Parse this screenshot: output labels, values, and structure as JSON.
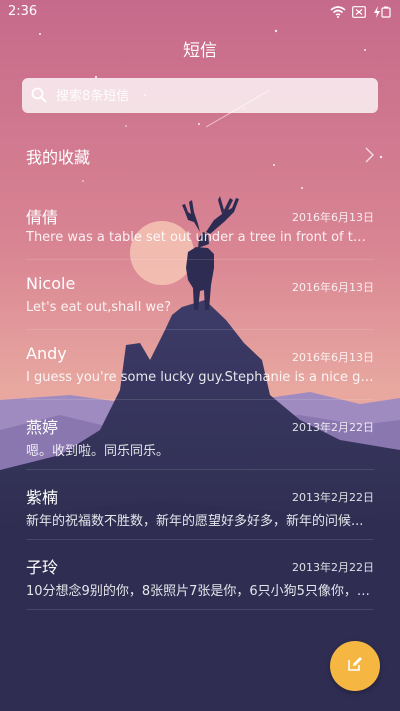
{
  "status_bar": {
    "time": "2:36",
    "icons": [
      "wifi-icon",
      "sim-card-icon",
      "charging-icon"
    ]
  },
  "header": {
    "title": "短信"
  },
  "search": {
    "placeholder": "搜索8条短信"
  },
  "favorites": {
    "label": "我的收藏",
    "icon": "chevron-right-icon"
  },
  "conversations": [
    {
      "name": "倩倩",
      "date": "2016年6月13日",
      "preview": "There was a table set out under a tree in front of the ho..."
    },
    {
      "name": "Nicole",
      "date": "2016年6月13日",
      "preview": "Let's eat out,shall we?"
    },
    {
      "name": "Andy",
      "date": "2016年6月13日",
      "preview": "I guess you're some lucky guy.Stephanie is a nice girl."
    },
    {
      "name": "燕婷",
      "date": "2013年2月22日",
      "preview": "嗯。收到啦。同乐同乐。"
    },
    {
      "name": "紫楠",
      "date": "2013年2月22日",
      "preview": "新年的祝福数不胜数，新年的愿望好多好多，新年的问候..."
    },
    {
      "name": "子玲",
      "date": "2013年2月22日",
      "preview": "10分想念9别的你，8张照片7张是你，6只小狗5只像你，4..."
    }
  ],
  "fab": {
    "icon": "compose-icon",
    "color": "#f5b642"
  },
  "colors": {
    "sky_top": "#c96f8f",
    "sky_bottom": "#e7a49f",
    "hills": "#8d7bb3",
    "mountain": "#3d3b67",
    "accent": "#f5b642"
  }
}
